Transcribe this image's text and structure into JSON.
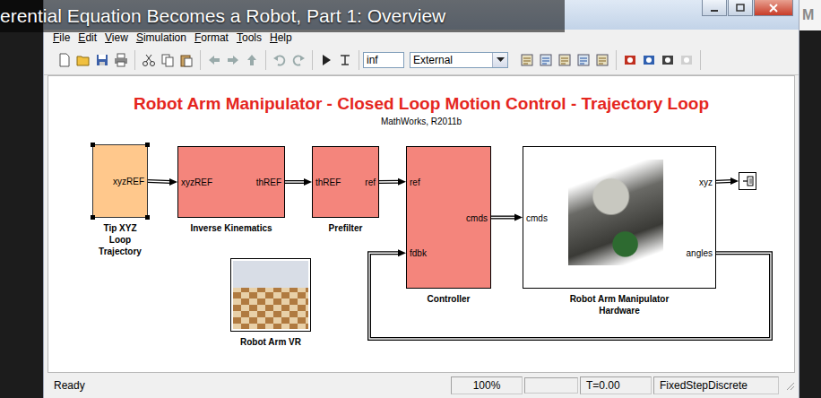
{
  "video_caption": "erential Equation Becomes a Robot, Part 1: Overview",
  "corner_mark": "M",
  "menu": [
    "File",
    "Edit",
    "View",
    "Simulation",
    "Format",
    "Tools",
    "Help"
  ],
  "toolbar": {
    "stop_time": "inf",
    "mode": "External"
  },
  "diagram": {
    "title": "Robot Arm Manipulator - Closed Loop Motion Control - Trajectory Loop",
    "subtitle": "MathWorks, R2011b",
    "blocks": [
      {
        "kind": "source",
        "name": "Tip XYZ Loop Trajectory",
        "color": "#ffc88c",
        "selected": true,
        "inputs": [],
        "outputs": [
          "xyzREF"
        ]
      },
      {
        "kind": "subsystem",
        "name": "Inverse Kinematics",
        "color": "#f4857c",
        "selected": false,
        "inputs": [
          "xyzREF"
        ],
        "outputs": [
          "thREF"
        ]
      },
      {
        "kind": "subsystem",
        "name": "Prefilter",
        "color": "#f4857c",
        "selected": false,
        "inputs": [
          "thREF"
        ],
        "outputs": [
          "ref"
        ]
      },
      {
        "kind": "subsystem",
        "name": "Controller",
        "color": "#f4857c",
        "selected": false,
        "inputs": [
          "ref",
          "fdbk"
        ],
        "outputs": [
          "cmds"
        ]
      },
      {
        "kind": "hardware",
        "name": "Robot Arm Manipulator Hardware",
        "color": "#ffffff",
        "selected": false,
        "inputs": [
          "cmds"
        ],
        "outputs": [
          "xyz",
          "angles"
        ]
      },
      {
        "kind": "vr",
        "name": "Robot Arm VR",
        "color": "#ffffff",
        "selected": false,
        "inputs": [],
        "outputs": []
      },
      {
        "kind": "outport",
        "color": "#ffffff",
        "selected": false,
        "inputs": [
          "in"
        ],
        "outputs": []
      }
    ]
  },
  "status_bar": {
    "message": "Ready",
    "zoom": "100%",
    "time": "T=0.00",
    "solver": "FixedStepDiscrete"
  }
}
